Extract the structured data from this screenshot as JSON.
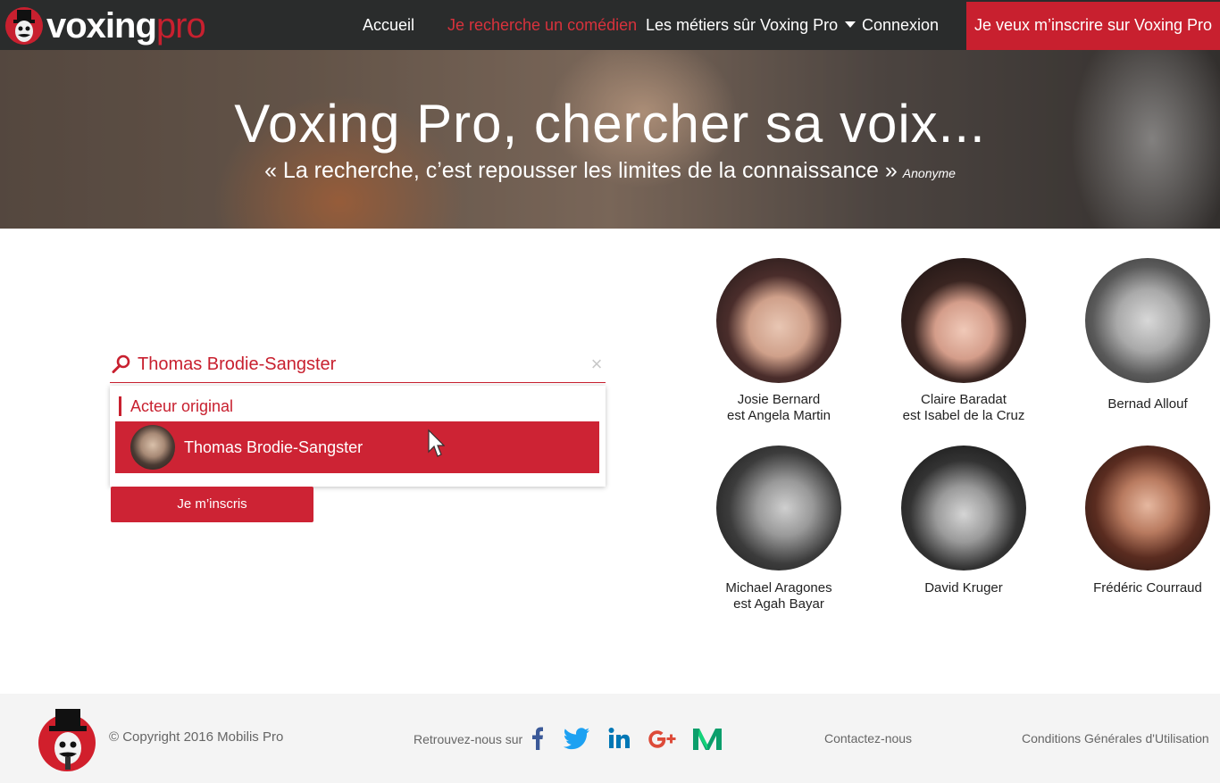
{
  "brand": {
    "name_part1": "voxing",
    "name_part2": "pro",
    "accent": "#c8202f"
  },
  "nav": {
    "items": [
      {
        "label": "Accueil",
        "active": false
      },
      {
        "label": "Je recherche un comédien",
        "active": true
      },
      {
        "label": "Les métiers sûr Voxing Pro",
        "active": false,
        "icon": "caret-down-icon"
      },
      {
        "label": "Connexion",
        "active": false
      }
    ],
    "cta": "Je veux m’inscrire sur Voxing Pro"
  },
  "hero": {
    "title": "Voxing Pro, chercher sa voix...",
    "quote": "« La recherche, c’est repousser les limites de la connaissance »",
    "author": "Anonyme"
  },
  "search": {
    "value": "Thomas Brodie-Sangster",
    "clear": "×",
    "dropdown": {
      "category": "Acteur original",
      "results": [
        {
          "name": "Thomas Brodie-Sangster"
        }
      ]
    },
    "button": "Je m’inscris"
  },
  "actors": [
    {
      "line1": "Josie Bernard",
      "line2": "est Angela Martin"
    },
    {
      "line1": "Claire Baradat",
      "line2": "est Isabel de la Cruz"
    },
    {
      "line1": "Bernad Allouf",
      "line2": ""
    },
    {
      "line1": "Michael Aragones",
      "line2": "est Agah Bayar"
    },
    {
      "line1": "David Kruger",
      "line2": ""
    },
    {
      "line1": "Frédéric Courraud",
      "line2": ""
    }
  ],
  "footer": {
    "copyright": "© Copyright 2016 Mobilis Pro",
    "follow": "Retrouvez-nous sur",
    "social": [
      "facebook-icon",
      "twitter-icon",
      "linkedin-icon",
      "google-plus-icon",
      "medium-icon"
    ],
    "contact": "Contactez-nous",
    "cgu": "Conditions Générales d'Utilisation"
  }
}
